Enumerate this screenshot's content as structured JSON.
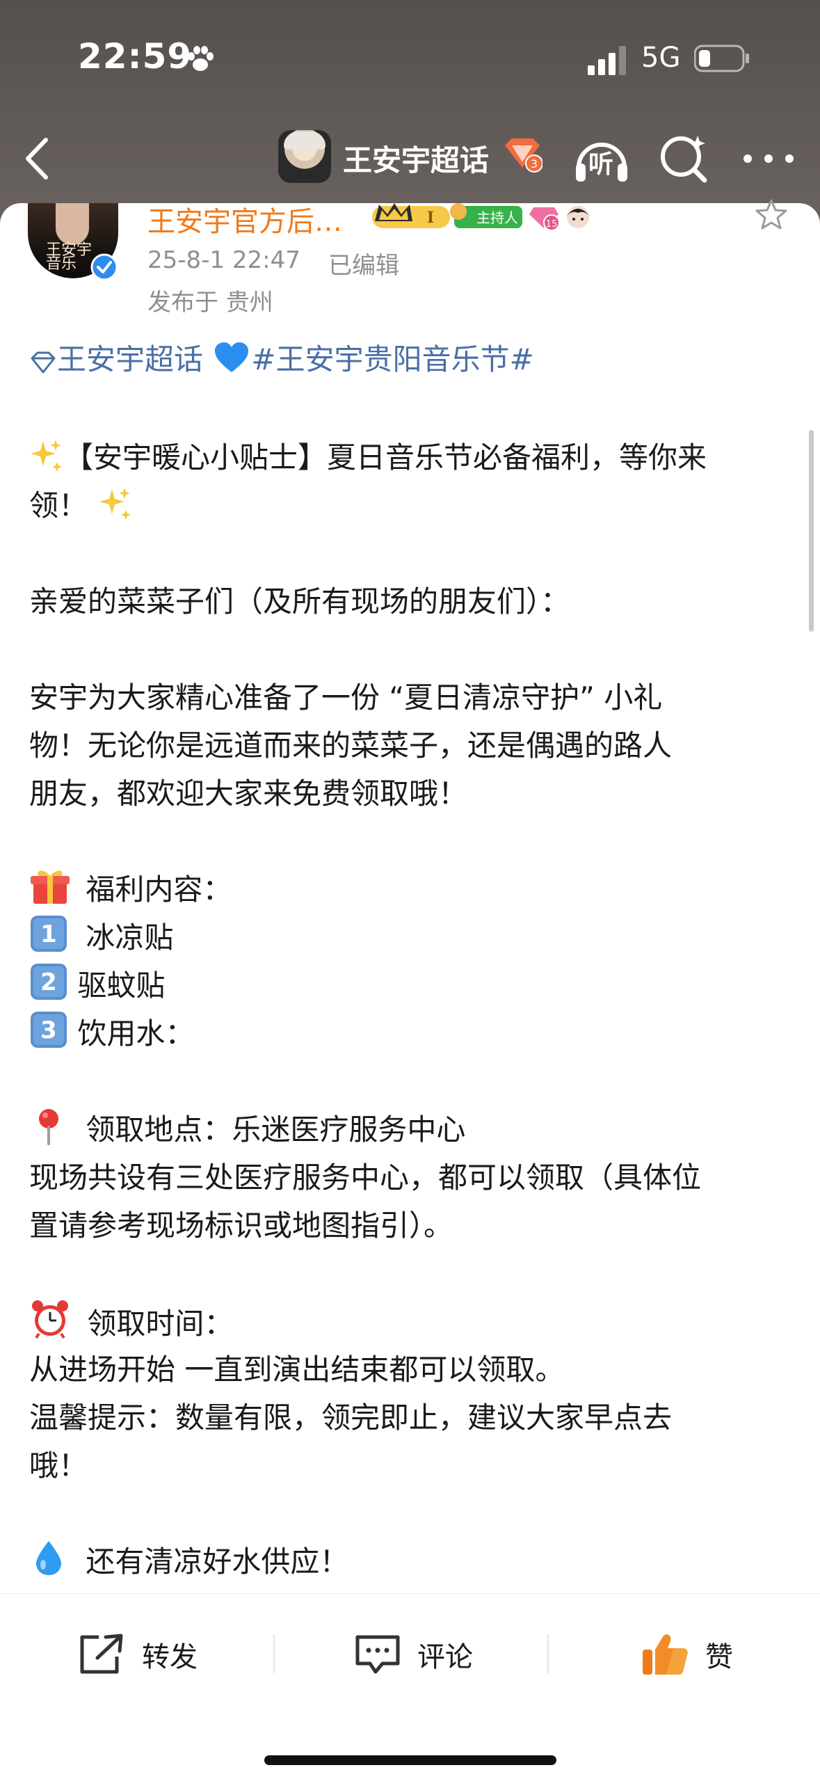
{
  "status_bar": {
    "time": "22:59",
    "network": "5G"
  },
  "nav": {
    "title": "王安宇超话",
    "listen_label": "听"
  },
  "post": {
    "author": "王安宇官方后…",
    "host_badge": "主持人",
    "level_badge": "I",
    "fans_level": "15",
    "date": "25-8-1 22:47",
    "edited": "已编辑",
    "location": "发布于 贵州",
    "topic_link": "王安宇超话",
    "hashtag": "#王安宇贵阳音乐节#",
    "heading_1": "【安宇暖心小贴士】夏日音乐节必备福利，等你来",
    "heading_2": "领！",
    "greeting": "亲爱的菜菜子们（及所有现场的朋友们）：",
    "para_1": "安宇为大家精心准备了一份 “夏日清凉守护” 小礼",
    "para_2": "物！无论你是远道而来的菜菜子，还是偶遇的路人",
    "para_3": "朋友，都欢迎大家来免费领取哦！",
    "benefits_title": "福利内容：",
    "item_1_num": "1",
    "item_1": "冰凉贴",
    "item_2_num": "2",
    "item_2": "驱蚊贴",
    "item_3_num": "3",
    "item_3": "饮用水：",
    "location_title": "领取地点：乐迷医疗服务中心",
    "location_desc_1": "现场共设有三处医疗服务中心，都可以领取（具体位",
    "location_desc_2": "置请参考现场标识或地图指引）。",
    "time_title": "领取时间：",
    "time_desc": "从进场开始 一直到演出结束都可以领取。",
    "tip_1": "温馨提示：数量有限，领完即止，建议大家早点去",
    "tip_2": "哦！",
    "water": "还有清凉好水供应！"
  },
  "actions": {
    "forward": "转发",
    "comment": "评论",
    "like": "赞"
  },
  "colors": {
    "author": "#f07a1a",
    "link": "#4a6fa5",
    "meta": "#8f8f8f"
  },
  "icons": [
    "back-arrow-icon",
    "listen-icon",
    "search-icon",
    "more-icon",
    "star-icon",
    "gift-icon",
    "pin-icon",
    "alarm-clock-icon",
    "droplet-icon",
    "sparkles-icon",
    "blue-heart-icon",
    "forward-icon",
    "comment-icon",
    "thumbs-up-icon"
  ]
}
